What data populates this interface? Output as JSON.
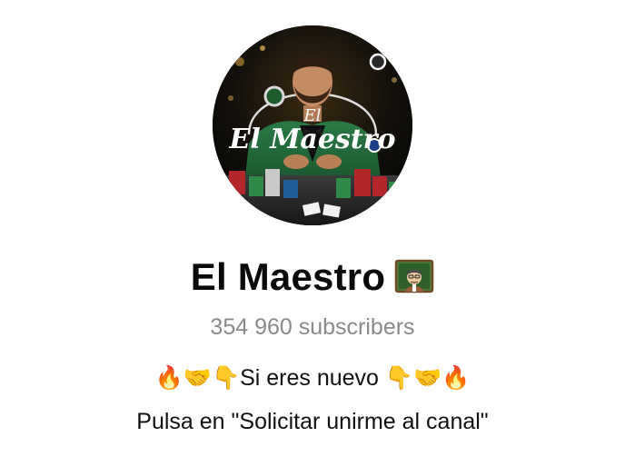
{
  "channel": {
    "name": "El Maestro",
    "name_emoji_icon": "teacher-icon",
    "avatar_logo_text": "El Maestro",
    "subscribers": "354 960 subscribers",
    "description_line1": "🔥🤝👇Si eres nuevo  👇🤝🔥",
    "description_line2": "Pulsa en \"Solicitar unirme al canal\""
  },
  "colors": {
    "background": "#ffffff",
    "title": "#0a0a0a",
    "subscribers": "#8a8a8a",
    "suit_green": "#1d5a32",
    "chip_red": "#b3262b"
  }
}
